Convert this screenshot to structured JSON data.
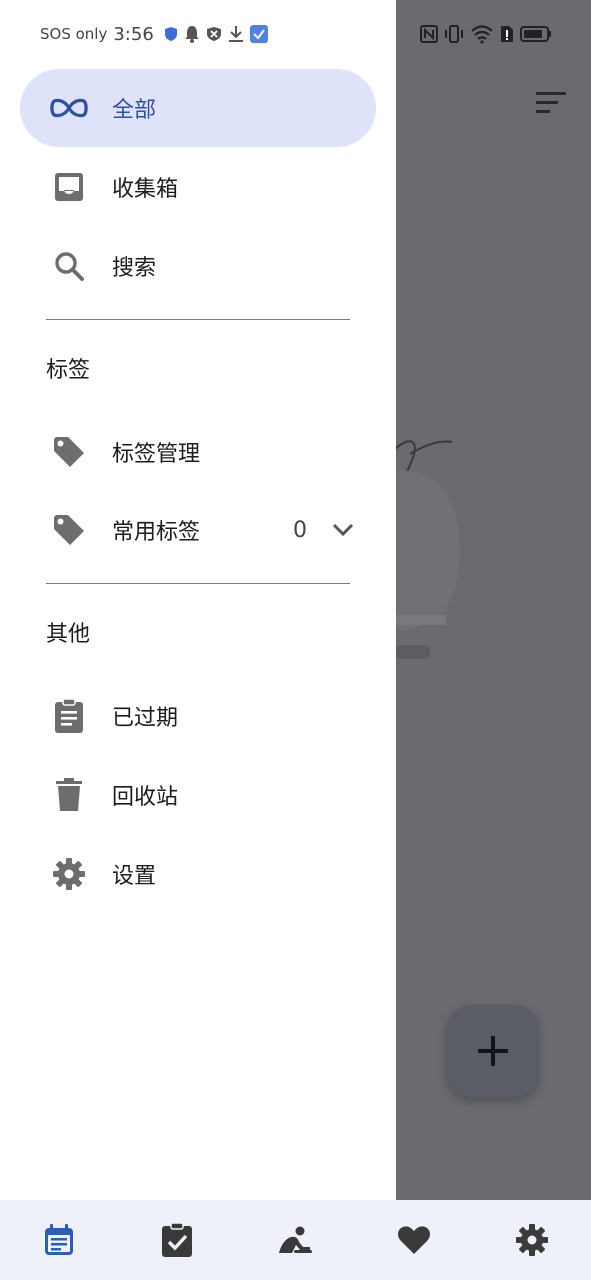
{
  "status_bar": {
    "carrier": "SOS only",
    "time": "3:56"
  },
  "drawer": {
    "items": [
      {
        "label": "全部",
        "icon": "infinity-icon",
        "active": true
      },
      {
        "label": "收集箱",
        "icon": "inbox-icon"
      },
      {
        "label": "搜索",
        "icon": "search-icon"
      }
    ],
    "tags_section": {
      "title": "标签",
      "items": [
        {
          "label": "标签管理",
          "icon": "tag-icon"
        },
        {
          "label": "常用标签",
          "icon": "tag-icon",
          "count": "0"
        }
      ]
    },
    "other_section": {
      "title": "其他",
      "items": [
        {
          "label": "已过期",
          "icon": "clipboard-icon"
        },
        {
          "label": "回收站",
          "icon": "trash-icon"
        },
        {
          "label": "设置",
          "icon": "gear-icon"
        }
      ]
    }
  },
  "colors": {
    "accent": "#2e4fa3",
    "active_bg": "#dfe3fa",
    "scrim": "#6a6b70",
    "bottom_nav_bg": "#eef1f9"
  },
  "bottom_nav": {
    "items": [
      {
        "icon": "calendar-icon",
        "active": true
      },
      {
        "icon": "clipboard-check-icon"
      },
      {
        "icon": "meditation-icon"
      },
      {
        "icon": "heart-icon"
      },
      {
        "icon": "gear-icon"
      }
    ]
  }
}
